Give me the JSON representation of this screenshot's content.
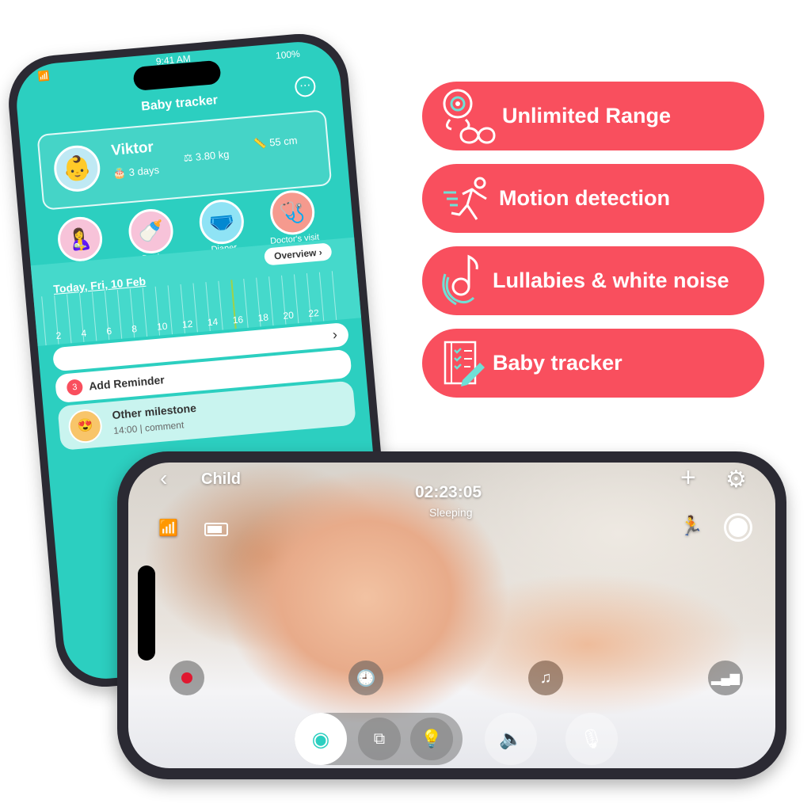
{
  "tracker_app": {
    "status_bar": {
      "time": "9:41 AM",
      "battery": "100%"
    },
    "title": "Baby tracker",
    "more_icon": "ellipsis-circle-icon",
    "profile": {
      "name": "Viktor",
      "age": "3 days",
      "weight": "3.80 kg",
      "height": "55 cm"
    },
    "categories": [
      {
        "label": "Breastfeeding",
        "color": "#f7c3d9"
      },
      {
        "label": "Bottle",
        "color": "#f7c3d9"
      },
      {
        "label": "Diaper",
        "color": "#8fe3f5"
      },
      {
        "label": "Doctor's visit",
        "color": "#f59a8e"
      }
    ],
    "overview_label": "Overview",
    "date_label": "Today, Fri, 10 Feb",
    "hours": [
      "2",
      "4",
      "6",
      "8",
      "10",
      "12",
      "14",
      "16",
      "18",
      "20",
      "22"
    ],
    "reminder": {
      "label": "Add Reminder",
      "badge": "3"
    },
    "milestone": {
      "title": "Other milestone",
      "time": "14:00",
      "comment": "comment"
    }
  },
  "features": [
    {
      "label": "Unlimited Range",
      "icon": "camera-infinity-icon"
    },
    {
      "label": "Motion detection",
      "icon": "running-person-icon"
    },
    {
      "label": "Lullabies & white noise",
      "icon": "music-note-icon"
    },
    {
      "label": "Baby tracker",
      "icon": "checklist-pencil-icon"
    }
  ],
  "colors": {
    "accent_red": "#f94f5e",
    "teal": "#2ccfc0",
    "icon_teal": "#6fe0d6"
  },
  "camera_view": {
    "back_icon": "chevron-left-icon",
    "title": "Child",
    "timer": "02:23:05",
    "status": "Sleeping",
    "left_controls": [
      "wifi-icon",
      "battery-icon"
    ],
    "right_controls": [
      "plus-icon",
      "gear-icon",
      "motion-icon",
      "snapshot-icon"
    ],
    "bottom_controls": [
      "record-icon",
      "history-icon",
      "lullaby-icon",
      "signal-icon",
      "camera-icon",
      "switch-camera-icon",
      "night-light-icon",
      "speaker-icon",
      "mic-muted-icon"
    ]
  }
}
